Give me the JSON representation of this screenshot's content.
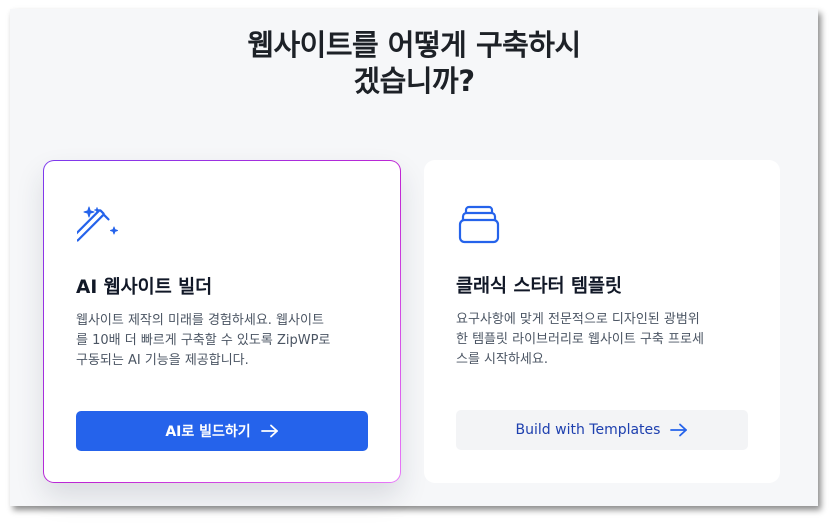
{
  "header": {
    "title_line1": "웹사이트를 어떻게 구축하시",
    "title_line2": "겠습니까?"
  },
  "cards": [
    {
      "icon": "magic-wand-icon",
      "title": "AI 웹사이트 빌더",
      "description_lines": [
        "웹사이트 제작의 미래를 경험하세요. 웹사이트",
        "를 10배 더 빠르게 구축할 수 있도록 ZipWP로",
        "구동되는 AI 기능을 제공합니다."
      ],
      "button_label": "AI로 빌드하기",
      "button_icon": "arrow-right-icon"
    },
    {
      "icon": "stacked-templates-icon",
      "title": "클래식 스타터 템플릿",
      "description_lines": [
        "요구사항에 맞게 전문적으로 디자인된 광범위",
        "한 템플릿 라이브러리로 웹사이트 구축 프로세",
        "스를 시작하세요."
      ],
      "button_label": "Build with Templates",
      "button_icon": "arrow-right-icon"
    }
  ],
  "colors": {
    "primary": "#2563eb",
    "secondary_button_bg": "#f3f4f6",
    "secondary_button_text": "#1e40af",
    "ai_card_border_gradient": [
      "#7c3aed",
      "#e879f9"
    ]
  }
}
